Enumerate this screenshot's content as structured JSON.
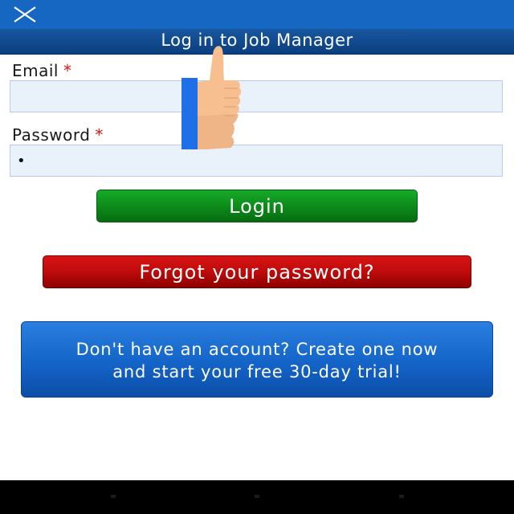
{
  "header": {
    "close_icon": "close-icon",
    "title": "Log in to Job Manager"
  },
  "form": {
    "email": {
      "label": "Email",
      "required_mark": "*",
      "value": ""
    },
    "password": {
      "label": "Password",
      "required_mark": "*",
      "value": "•"
    }
  },
  "buttons": {
    "login": "Login",
    "forgot": "Forgot your password?",
    "signup_line1": "Don't have an account? Create one now",
    "signup_line2": "and start your free 30-day trial!"
  },
  "overlay": {
    "icon": "thumbs-up-hand-icon"
  },
  "colors": {
    "appbar": "#1667c1",
    "titlebar": "#0c3f7f",
    "login_button": "#0d8c1b",
    "forgot_button": "#bb0a0a",
    "signup_button": "#1464c8",
    "required_mark": "#e01414"
  },
  "system_nav": {
    "icons": [
      "back-icon",
      "home-icon",
      "recents-icon"
    ]
  }
}
